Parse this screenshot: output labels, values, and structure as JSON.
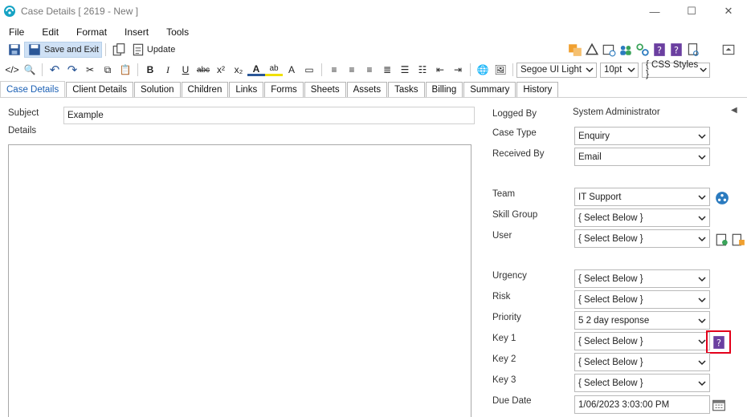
{
  "window": {
    "title": "Case Details [ 2619 - New ]",
    "controls": {
      "minimize": "—",
      "maximize": "☐",
      "close": "✕"
    }
  },
  "menu": [
    "File",
    "Edit",
    "Format",
    "Insert",
    "Tools"
  ],
  "toolbar": {
    "save_and_exit": "Save and Exit",
    "update": "Update"
  },
  "format_bar": {
    "font": "Segoe UI Light",
    "size": "10pt",
    "styles": "{ CSS Styles }"
  },
  "tabs": [
    "Case Details",
    "Client Details",
    "Solution",
    "Children",
    "Links",
    "Forms",
    "Sheets",
    "Assets",
    "Tasks",
    "Billing",
    "Summary",
    "History"
  ],
  "left": {
    "subject_label": "Subject",
    "subject_value": "Example",
    "details_label": "Details"
  },
  "right": {
    "logged_by_label": "Logged By",
    "logged_by_value": "System Administrator",
    "case_type_label": "Case Type",
    "case_type_value": "Enquiry",
    "received_by_label": "Received By",
    "received_by_value": "Email",
    "team_label": "Team",
    "team_value": "IT Support",
    "skill_group_label": "Skill Group",
    "skill_group_value": "{ Select Below }",
    "user_label": "User",
    "user_value": "{ Select Below }",
    "urgency_label": "Urgency",
    "urgency_value": "{ Select Below }",
    "risk_label": "Risk",
    "risk_value": "{ Select Below }",
    "priority_label": "Priority",
    "priority_value": "5 2 day response",
    "key1_label": "Key 1",
    "key1_value": "{ Select Below }",
    "key2_label": "Key 2",
    "key2_value": "{ Select Below }",
    "key3_label": "Key 3",
    "key3_value": "{ Select Below }",
    "due_date_label": "Due Date",
    "due_date_value": "1/06/2023 3:03:00 PM"
  },
  "colors": {
    "accent": "#1a5fb4",
    "highlight": "#e3001b",
    "purple_icon": "#6b3fa0"
  }
}
